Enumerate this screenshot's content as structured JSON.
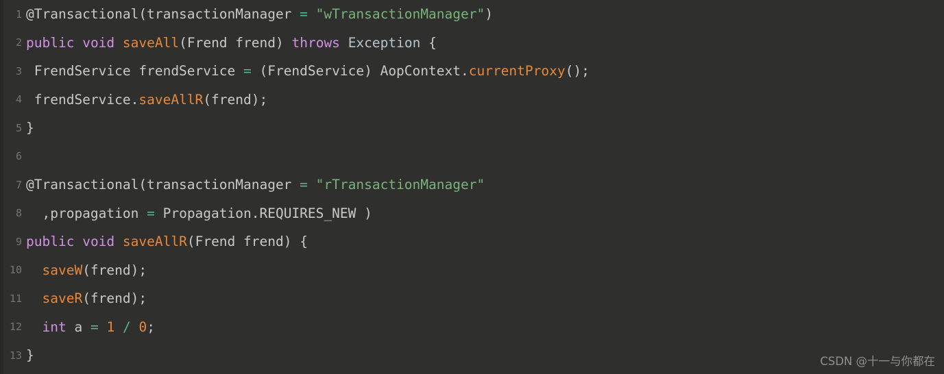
{
  "editor": {
    "background_color": "#2f2f2e",
    "gutter_color": "#757575",
    "default_text_color": "#c9c9c9",
    "language": "Java"
  },
  "palette": {
    "keyword": "#d291e4",
    "method": "#e8883a",
    "string": "#79b27b",
    "operator": "#50b896",
    "type": "#b8c4cc",
    "number": "#e8883a",
    "variable": "#9fc4d4",
    "plain": "#c9c9c9",
    "line_number": "#757575"
  },
  "watermark": {
    "text": "CSDN @十一与你都在"
  },
  "code": {
    "lines": [
      {
        "number": "1",
        "text": "@Transactional(transactionManager = \"wTransactionManager\")",
        "tokens": [
          {
            "t": "@Transactional(transactionManager ",
            "c": "plain"
          },
          {
            "t": "=",
            "c": "operator"
          },
          {
            "t": " ",
            "c": "plain"
          },
          {
            "t": "\"wTransactionManager\"",
            "c": "string"
          },
          {
            "t": ")",
            "c": "plain"
          }
        ]
      },
      {
        "number": "2",
        "text": "public void saveAll(Frend frend) throws Exception {",
        "tokens": [
          {
            "t": "public",
            "c": "keyword"
          },
          {
            "t": " ",
            "c": "plain"
          },
          {
            "t": "void",
            "c": "keyword"
          },
          {
            "t": " ",
            "c": "plain"
          },
          {
            "t": "saveAll",
            "c": "method"
          },
          {
            "t": "(Frend frend) ",
            "c": "plain"
          },
          {
            "t": "throws",
            "c": "keyword"
          },
          {
            "t": " ",
            "c": "plain"
          },
          {
            "t": "Exception",
            "c": "type"
          },
          {
            "t": " {",
            "c": "plain"
          }
        ]
      },
      {
        "number": "3",
        "text": " FrendService frendService = (FrendService) AopContext.currentProxy();",
        "tokens": [
          {
            "t": " FrendService frendService ",
            "c": "plain"
          },
          {
            "t": "=",
            "c": "operator"
          },
          {
            "t": " (FrendService) AopContext.",
            "c": "plain"
          },
          {
            "t": "currentProxy",
            "c": "method"
          },
          {
            "t": "();",
            "c": "plain"
          }
        ]
      },
      {
        "number": "4",
        "text": " frendService.saveAllR(frend);",
        "tokens": [
          {
            "t": " frendService.",
            "c": "plain"
          },
          {
            "t": "saveAllR",
            "c": "method"
          },
          {
            "t": "(frend);",
            "c": "plain"
          }
        ]
      },
      {
        "number": "5",
        "text": "}",
        "tokens": [
          {
            "t": "}",
            "c": "plain"
          }
        ]
      },
      {
        "number": "6",
        "text": "",
        "tokens": []
      },
      {
        "number": "7",
        "text": "@Transactional(transactionManager = \"rTransactionManager\"",
        "tokens": [
          {
            "t": "@Transactional(transactionManager ",
            "c": "plain"
          },
          {
            "t": "=",
            "c": "operator"
          },
          {
            "t": " ",
            "c": "plain"
          },
          {
            "t": "\"rTransactionManager\"",
            "c": "string"
          }
        ]
      },
      {
        "number": "8",
        "text": "  ,propagation = Propagation.REQUIRES_NEW )",
        "tokens": [
          {
            "t": "  ,propagation ",
            "c": "plain"
          },
          {
            "t": "=",
            "c": "operator"
          },
          {
            "t": " Propagation.REQUIRES_NEW )",
            "c": "plain"
          }
        ]
      },
      {
        "number": "9",
        "text": "public void saveAllR(Frend frend) {",
        "tokens": [
          {
            "t": "public",
            "c": "keyword"
          },
          {
            "t": " ",
            "c": "plain"
          },
          {
            "t": "void",
            "c": "keyword"
          },
          {
            "t": " ",
            "c": "plain"
          },
          {
            "t": "saveAllR",
            "c": "method"
          },
          {
            "t": "(Frend frend) {",
            "c": "plain"
          }
        ]
      },
      {
        "number": "10",
        "text": "  saveW(frend);",
        "tokens": [
          {
            "t": "  ",
            "c": "plain"
          },
          {
            "t": "saveW",
            "c": "method"
          },
          {
            "t": "(frend);",
            "c": "plain"
          }
        ]
      },
      {
        "number": "11",
        "text": "  saveR(frend);",
        "tokens": [
          {
            "t": "  ",
            "c": "plain"
          },
          {
            "t": "saveR",
            "c": "method"
          },
          {
            "t": "(frend);",
            "c": "plain"
          }
        ]
      },
      {
        "number": "12",
        "text": "  int a = 1 / 0;",
        "tokens": [
          {
            "t": "  ",
            "c": "plain"
          },
          {
            "t": "int",
            "c": "keyword"
          },
          {
            "t": " ",
            "c": "plain"
          },
          {
            "t": "a",
            "c": "variable"
          },
          {
            "t": " ",
            "c": "plain"
          },
          {
            "t": "=",
            "c": "operator"
          },
          {
            "t": " ",
            "c": "plain"
          },
          {
            "t": "1",
            "c": "number"
          },
          {
            "t": " ",
            "c": "plain"
          },
          {
            "t": "/",
            "c": "operator"
          },
          {
            "t": " ",
            "c": "plain"
          },
          {
            "t": "0",
            "c": "number"
          },
          {
            "t": ";",
            "c": "plain"
          }
        ]
      },
      {
        "number": "13",
        "text": "}",
        "tokens": [
          {
            "t": "}",
            "c": "plain"
          }
        ]
      }
    ]
  }
}
